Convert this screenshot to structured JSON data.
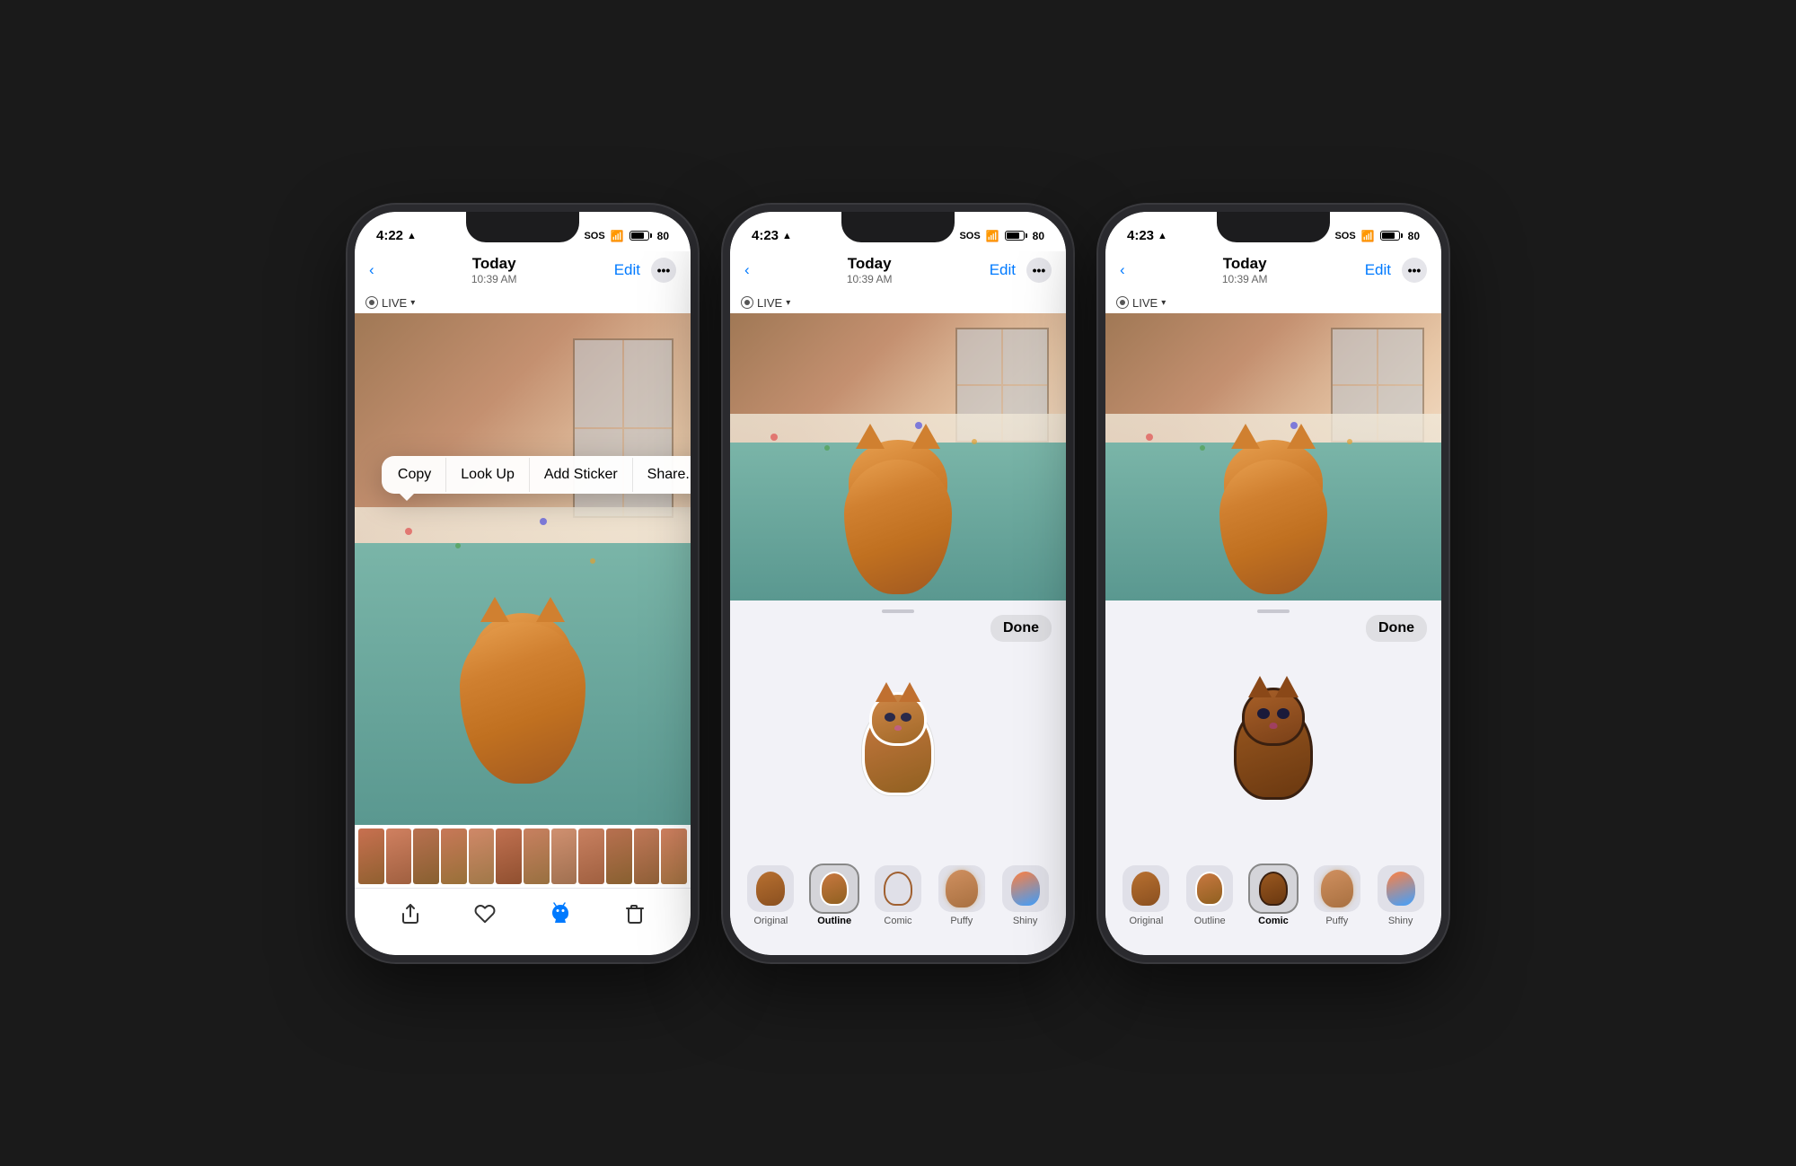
{
  "phones": [
    {
      "id": "phone1",
      "status": {
        "time": "4:22",
        "location": true,
        "sos": "SOS",
        "wifi": true,
        "battery": 80
      },
      "nav": {
        "title": "Today",
        "subtitle": "10:39 AM",
        "back_label": "",
        "edit_label": "Edit"
      },
      "live_label": "LIVE",
      "context_menu": {
        "items": [
          "Copy",
          "Look Up",
          "Add Sticker",
          "Share..."
        ]
      },
      "toolbar": {
        "share": "share",
        "favorite": "heart",
        "cat": "cat",
        "delete": "trash"
      }
    },
    {
      "id": "phone2",
      "status": {
        "time": "4:23",
        "location": true,
        "sos": "SOS",
        "wifi": true,
        "battery": 80
      },
      "nav": {
        "title": "Today",
        "subtitle": "10:39 AM",
        "back_label": "",
        "edit_label": "Edit"
      },
      "live_label": "LIVE",
      "sticker_panel": {
        "done_label": "Done",
        "drag_handle": true,
        "selected_style": "Outline",
        "styles": [
          "Original",
          "Outline",
          "Comic",
          "Puffy",
          "Shiny"
        ]
      }
    },
    {
      "id": "phone3",
      "status": {
        "time": "4:23",
        "location": true,
        "sos": "SOS",
        "wifi": true,
        "battery": 80
      },
      "nav": {
        "title": "Today",
        "subtitle": "10:39 AM",
        "back_label": "",
        "edit_label": "Edit"
      },
      "live_label": "LIVE",
      "sticker_panel": {
        "done_label": "Done",
        "drag_handle": true,
        "selected_style": "Comic",
        "styles": [
          "Original",
          "Outline",
          "Comic",
          "Puffy",
          "Shiny"
        ]
      }
    }
  ],
  "background_color": "#1a1a1a"
}
